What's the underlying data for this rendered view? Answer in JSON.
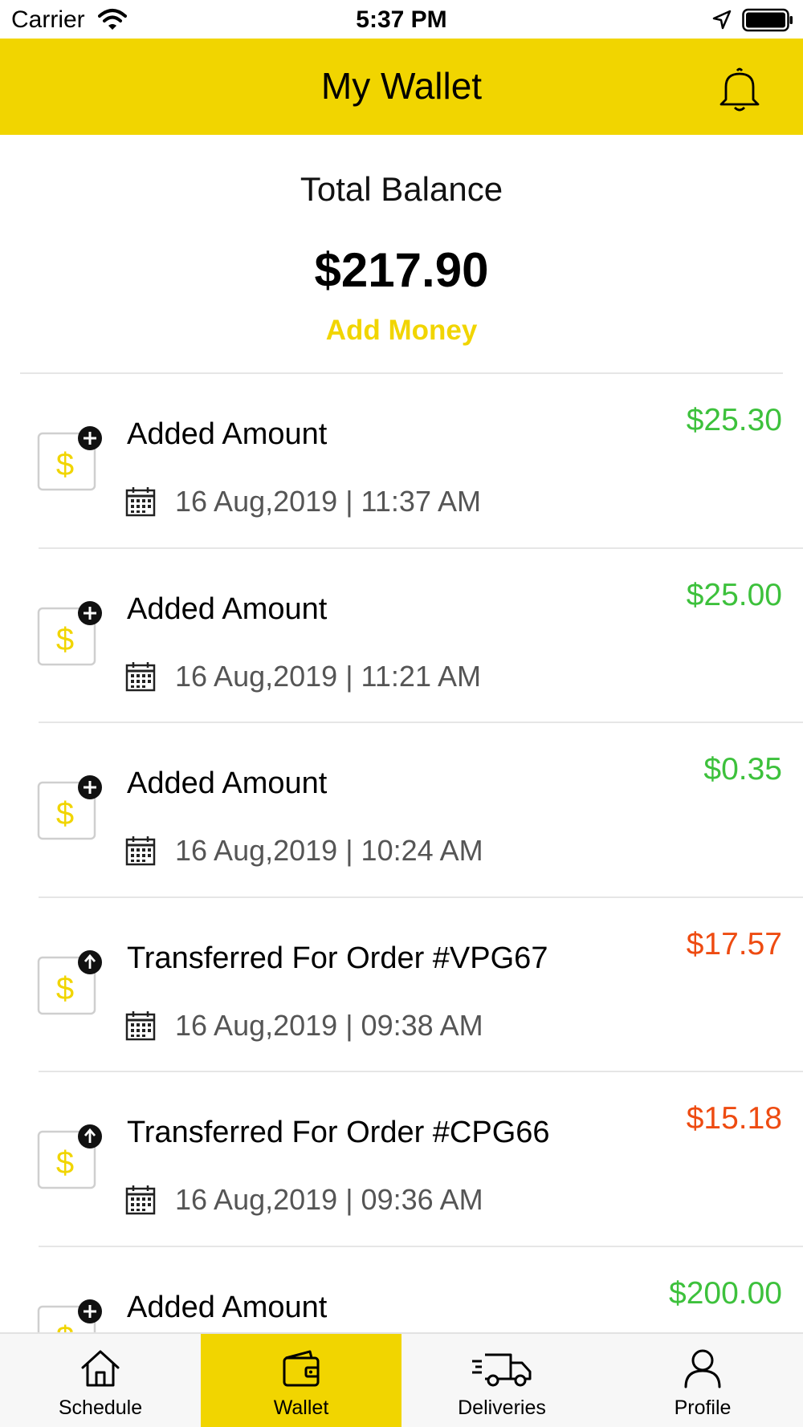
{
  "status_bar": {
    "carrier": "Carrier",
    "time": "5:37 PM",
    "icons": [
      "wifi-icon",
      "location-arrow-icon",
      "battery-icon"
    ]
  },
  "header": {
    "title": "My Wallet",
    "icon": "bell-icon",
    "background": "#f1d500"
  },
  "balance": {
    "label": "Total Balance",
    "amount": "$217.90",
    "add_money_label": "Add Money"
  },
  "transactions": [
    {
      "type": "credit",
      "icon": "dollar-add-icon",
      "title": "Added Amount",
      "date": "16 Aug,2019 | 11:37 AM",
      "amount": "$25.30"
    },
    {
      "type": "credit",
      "icon": "dollar-add-icon",
      "title": "Added Amount",
      "date": "16 Aug,2019 | 11:21 AM",
      "amount": "$25.00"
    },
    {
      "type": "credit",
      "icon": "dollar-add-icon",
      "title": "Added Amount",
      "date": "16 Aug,2019 | 10:24 AM",
      "amount": "$0.35"
    },
    {
      "type": "debit",
      "icon": "dollar-transfer-icon",
      "title": "Transferred For Order #VPG67",
      "date": "16 Aug,2019 | 09:38 AM",
      "amount": "$17.57"
    },
    {
      "type": "debit",
      "icon": "dollar-transfer-icon",
      "title": "Transferred For Order #CPG66",
      "date": "16 Aug,2019 | 09:36 AM",
      "amount": "$15.18"
    },
    {
      "type": "credit",
      "icon": "dollar-add-icon",
      "title": "Added Amount",
      "date": "",
      "amount": "$200.00"
    }
  ],
  "colors": {
    "accent": "#f1d500",
    "credit": "#3dc13c",
    "debit": "#ee4b11"
  },
  "tabs": [
    {
      "label": "Schedule",
      "icon": "home-icon",
      "active": false
    },
    {
      "label": "Wallet",
      "icon": "wallet-icon",
      "active": true
    },
    {
      "label": "Deliveries",
      "icon": "truck-icon",
      "active": false
    },
    {
      "label": "Profile",
      "icon": "person-icon",
      "active": false
    }
  ]
}
